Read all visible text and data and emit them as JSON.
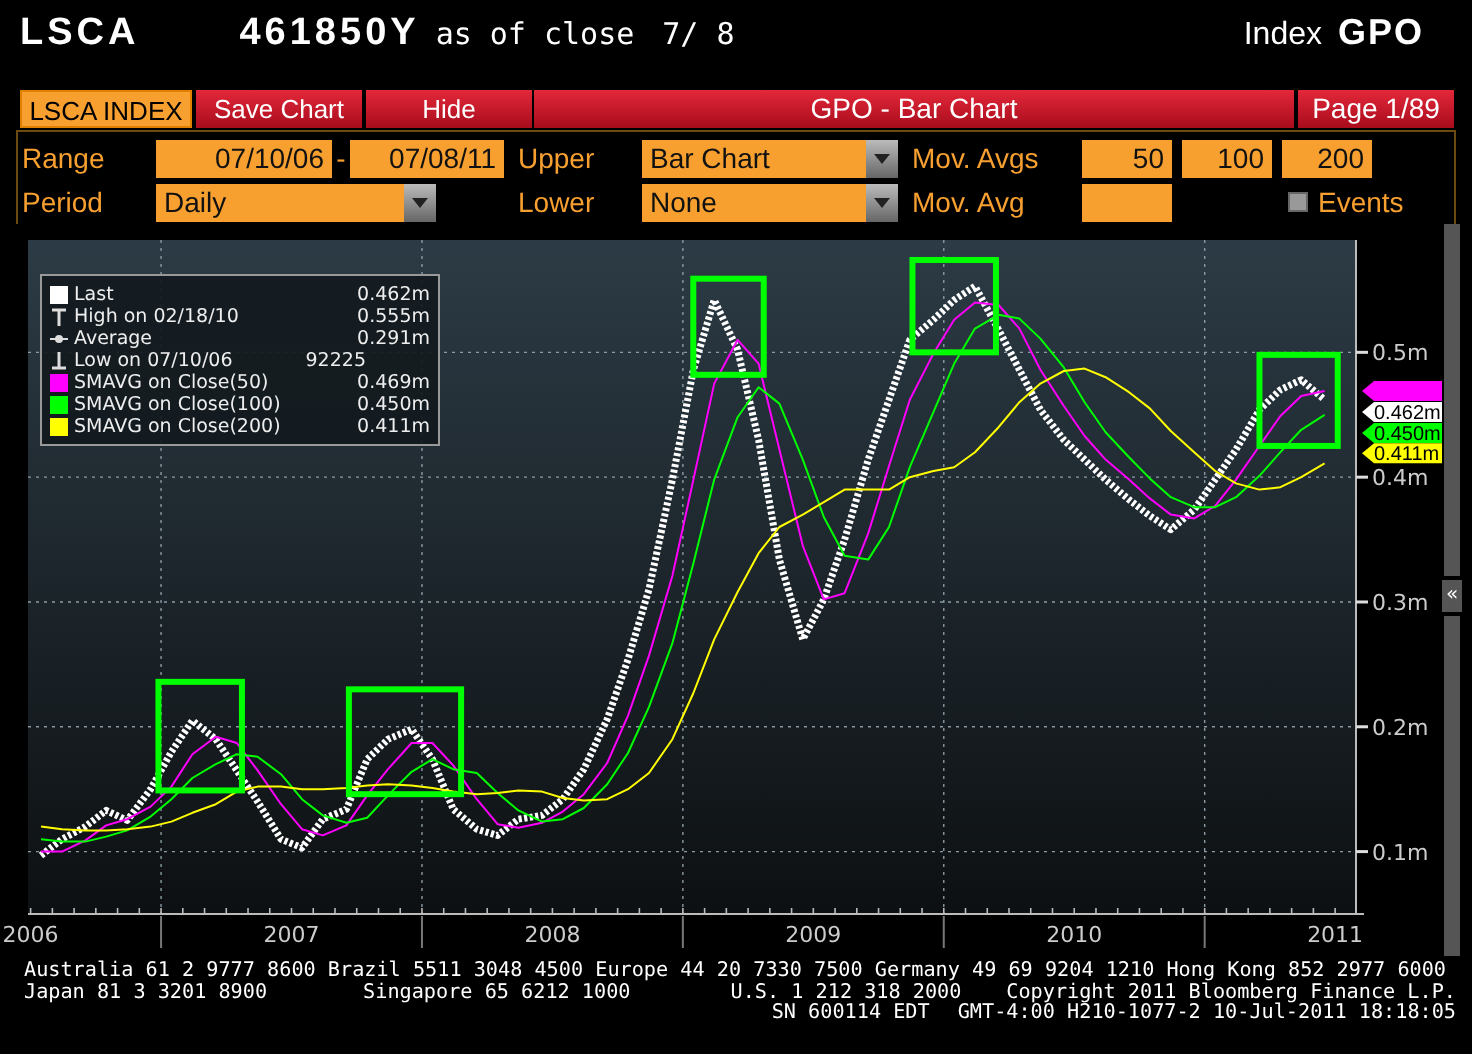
{
  "header": {
    "ticker": "LSCA",
    "number": "461850Y",
    "as_of": "as of close",
    "date": "7/ 8",
    "index_label": "Index",
    "function": "GPO"
  },
  "toolbar": {
    "security": "LSCA INDEX",
    "buttons": [
      "Save Chart",
      "Hide"
    ],
    "title": "GPO - Bar Chart",
    "page": "Page 1/89"
  },
  "controls": {
    "range": {
      "label": "Range",
      "from": "07/10/06",
      "separator": "-",
      "to": "07/08/11"
    },
    "upper": {
      "label": "Upper",
      "value": "Bar Chart"
    },
    "mov_avgs": {
      "label": "Mov. Avgs",
      "values": [
        "50",
        "100",
        "200"
      ]
    },
    "period": {
      "label": "Period",
      "value": "Daily"
    },
    "lower": {
      "label": "Lower",
      "value": "None"
    },
    "mov_avg": {
      "label": "Mov. Avg"
    },
    "events": {
      "label": "Events",
      "checked": false
    }
  },
  "chart": {
    "legend_rows": [
      {
        "kind": "series",
        "value": "0.462m"
      },
      {
        "kind": "high",
        "label": "High on 02/18/10",
        "value": "0.555m"
      },
      {
        "kind": "average",
        "label": "Average",
        "value": "0.291m"
      },
      {
        "kind": "low",
        "label": "Low on 07/10/06",
        "value": "92225"
      },
      {
        "kind": "series",
        "value": "0.469m"
      },
      {
        "kind": "series",
        "value": "0.450m"
      },
      {
        "kind": "series",
        "value": "0.411m"
      }
    ],
    "price_flags": [
      {
        "color": "#ff00ff"
      },
      {
        "label": "0.462m",
        "color": "#ffffff"
      },
      {
        "label": "0.450m",
        "color": "#00ff00"
      },
      {
        "label": "0.411m",
        "color": "#ffff00"
      }
    ],
    "scroll_button": "«",
    "chart_data": {
      "type": "line",
      "grid": true,
      "legend": "upper left",
      "x": [
        2006.54,
        2006.62,
        2006.71,
        2006.79,
        2006.87,
        2006.96,
        2007.04,
        2007.12,
        2007.21,
        2007.29,
        2007.37,
        2007.46,
        2007.54,
        2007.62,
        2007.71,
        2007.79,
        2007.87,
        2007.96,
        2008.04,
        2008.12,
        2008.21,
        2008.29,
        2008.37,
        2008.46,
        2008.54,
        2008.62,
        2008.71,
        2008.79,
        2008.87,
        2008.96,
        2009.04,
        2009.12,
        2009.21,
        2009.29,
        2009.37,
        2009.46,
        2009.54,
        2009.62,
        2009.71,
        2009.79,
        2009.87,
        2009.96,
        2010.04,
        2010.12,
        2010.21,
        2010.29,
        2010.37,
        2010.46,
        2010.54,
        2010.62,
        2010.71,
        2010.79,
        2010.87,
        2010.96,
        2011.04,
        2011.12,
        2011.21,
        2011.29,
        2011.37,
        2011.46
      ],
      "series": [
        {
          "name": "Last",
          "color": "#ffffff",
          "line_style": "dashed",
          "values": [
            0.097,
            0.11,
            0.12,
            0.133,
            0.125,
            0.15,
            0.18,
            0.205,
            0.19,
            0.165,
            0.14,
            0.11,
            0.103,
            0.126,
            0.134,
            0.174,
            0.19,
            0.198,
            0.174,
            0.134,
            0.118,
            0.113,
            0.126,
            0.129,
            0.142,
            0.166,
            0.206,
            0.254,
            0.31,
            0.398,
            0.486,
            0.542,
            0.502,
            0.43,
            0.334,
            0.27,
            0.302,
            0.35,
            0.414,
            0.462,
            0.51,
            0.526,
            0.542,
            0.553,
            0.518,
            0.486,
            0.454,
            0.43,
            0.414,
            0.398,
            0.382,
            0.369,
            0.358,
            0.374,
            0.398,
            0.422,
            0.454,
            0.47,
            0.478,
            0.462
          ]
        },
        {
          "name": "SMAVG on Close(50)",
          "color": "#ff00ff",
          "line_style": "solid",
          "values": [
            0.1,
            0.1,
            0.109,
            0.121,
            0.126,
            0.136,
            0.152,
            0.178,
            0.192,
            0.187,
            0.165,
            0.138,
            0.118,
            0.113,
            0.121,
            0.145,
            0.166,
            0.187,
            0.187,
            0.169,
            0.142,
            0.122,
            0.119,
            0.123,
            0.132,
            0.146,
            0.171,
            0.209,
            0.257,
            0.321,
            0.398,
            0.475,
            0.51,
            0.491,
            0.422,
            0.345,
            0.302,
            0.307,
            0.355,
            0.409,
            0.462,
            0.499,
            0.526,
            0.54,
            0.538,
            0.519,
            0.486,
            0.457,
            0.433,
            0.414,
            0.398,
            0.383,
            0.37,
            0.367,
            0.377,
            0.398,
            0.425,
            0.449,
            0.465,
            0.469
          ]
        },
        {
          "name": "SMAVG on Close(100)",
          "color": "#00ff00",
          "line_style": "solid",
          "values": [
            0.11,
            0.108,
            0.108,
            0.112,
            0.117,
            0.128,
            0.142,
            0.159,
            0.17,
            0.178,
            0.176,
            0.162,
            0.142,
            0.129,
            0.123,
            0.127,
            0.145,
            0.164,
            0.174,
            0.166,
            0.163,
            0.147,
            0.133,
            0.124,
            0.126,
            0.135,
            0.154,
            0.179,
            0.216,
            0.267,
            0.331,
            0.398,
            0.448,
            0.472,
            0.459,
            0.414,
            0.368,
            0.337,
            0.334,
            0.36,
            0.408,
            0.452,
            0.491,
            0.519,
            0.53,
            0.527,
            0.511,
            0.488,
            0.46,
            0.436,
            0.416,
            0.399,
            0.384,
            0.376,
            0.376,
            0.384,
            0.401,
            0.42,
            0.438,
            0.45
          ]
        },
        {
          "name": "SMAVG on Close(200)",
          "color": "#ffff00",
          "line_style": "solid",
          "values": [
            0.12,
            0.118,
            0.117,
            0.117,
            0.118,
            0.12,
            0.124,
            0.131,
            0.138,
            0.148,
            0.152,
            0.152,
            0.15,
            0.15,
            0.151,
            0.153,
            0.154,
            0.153,
            0.151,
            0.148,
            0.146,
            0.147,
            0.149,
            0.148,
            0.143,
            0.141,
            0.142,
            0.15,
            0.163,
            0.19,
            0.227,
            0.27,
            0.308,
            0.339,
            0.36,
            0.37,
            0.38,
            0.39,
            0.39,
            0.39,
            0.4,
            0.405,
            0.408,
            0.42,
            0.44,
            0.46,
            0.475,
            0.485,
            0.487,
            0.48,
            0.468,
            0.455,
            0.437,
            0.42,
            0.405,
            0.395,
            0.39,
            0.392,
            0.4,
            0.411
          ]
        }
      ],
      "xlim": [
        2006.49,
        2011.58
      ],
      "ylim": [
        0.05,
        0.59
      ],
      "xticks": [
        {
          "value": 2006.5,
          "label": "2006"
        },
        {
          "value": 2007.5,
          "label": "2007"
        },
        {
          "value": 2008.5,
          "label": "2008"
        },
        {
          "value": 2009.5,
          "label": "2009"
        },
        {
          "value": 2010.5,
          "label": "2010"
        },
        {
          "value": 2011.5,
          "label": "2011"
        }
      ],
      "yticks": [
        {
          "value": 0.1,
          "label": "0.1m"
        },
        {
          "value": 0.2,
          "label": "0.2m"
        },
        {
          "value": 0.3,
          "label": "0.3m"
        },
        {
          "value": 0.4,
          "label": "0.4m"
        },
        {
          "value": 0.5,
          "label": "0.5m"
        }
      ]
    }
  },
  "footer": {
    "line_1": "Australia 61 2 9777 8600 Brazil 5511 3048 4500 Europe 44 20 7330 7500 Germany 49 69 9204 1210 Hong Kong 852 2977 6000",
    "line_2": [
      "Japan 81 3 3201 8900",
      "Singapore 65 6212 1000",
      "U.S. 1 212 318 2000",
      "Copyright 2011 Bloomberg Finance L.P."
    ],
    "line_3": [
      "SN 600114 EDT",
      "GMT-4:00 H210-1077-2 10-Jul-2011 18:18:05"
    ]
  }
}
